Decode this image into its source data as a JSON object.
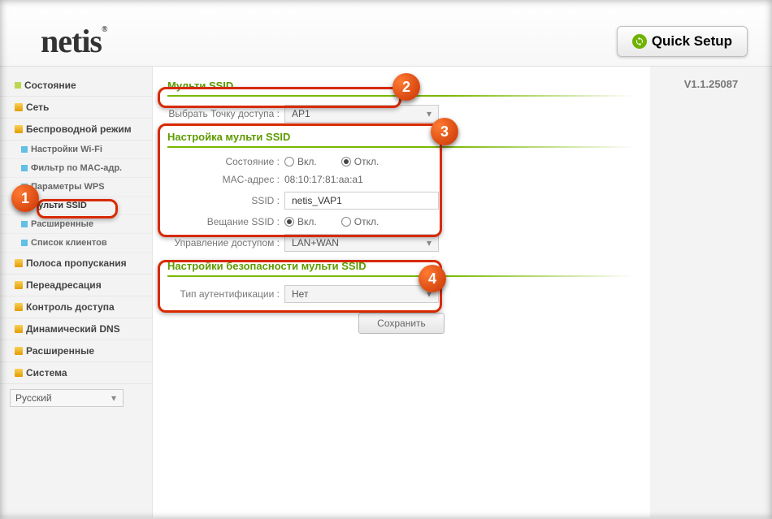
{
  "header": {
    "logo_text": "netis",
    "quick_setup_label": "Quick Setup"
  },
  "version": "V1.1.25087",
  "sidebar": {
    "items": [
      {
        "label": "Состояние",
        "type": "top"
      },
      {
        "label": "Сеть",
        "type": "top-exp"
      },
      {
        "label": "Беспроводной режим",
        "type": "top-exp"
      },
      {
        "label": "Настройки Wi-Fi",
        "type": "sub"
      },
      {
        "label": "Фильтр по MAC-адр.",
        "type": "sub"
      },
      {
        "label": "Параметры WPS",
        "type": "sub"
      },
      {
        "label": "Мульти SSID",
        "type": "sub",
        "active": true
      },
      {
        "label": "Расширенные",
        "type": "sub"
      },
      {
        "label": "Список клиентов",
        "type": "sub"
      },
      {
        "label": "Полоса пропускания",
        "type": "top-exp"
      },
      {
        "label": "Переадресация",
        "type": "top-exp"
      },
      {
        "label": "Контроль доступа",
        "type": "top-exp"
      },
      {
        "label": "Динамический DNS",
        "type": "top-exp"
      },
      {
        "label": "Расширенные",
        "type": "top-exp"
      },
      {
        "label": "Система",
        "type": "top-exp"
      }
    ],
    "language": "Русский"
  },
  "main": {
    "sections": {
      "multi_ssid_title": "Мульти SSID",
      "ap_select_label": "Выбрать Точку доступа :",
      "ap_select_value": "AP1",
      "config_title": "Настройка мульти SSID",
      "state_label": "Состояние :",
      "state_on": "Вкл.",
      "state_off": "Откл.",
      "state_value": "off",
      "mac_label": "MAC-адрес :",
      "mac_value": "08:10:17:81:aa:a1",
      "ssid_label": "SSID :",
      "ssid_value": "netis_VAP1",
      "broadcast_label": "Вещание SSID :",
      "broadcast_on": "Вкл.",
      "broadcast_off": "Откл.",
      "broadcast_value": "on",
      "access_label": "Управление доступом :",
      "access_value": "LAN+WAN",
      "security_title": "Настройки безопасности мульти SSID",
      "auth_label": "Тип аутентификации :",
      "auth_value": "Нет",
      "save_label": "Сохранить"
    }
  },
  "annotations": {
    "pin1": "1",
    "pin2": "2",
    "pin3": "3",
    "pin4": "4"
  }
}
